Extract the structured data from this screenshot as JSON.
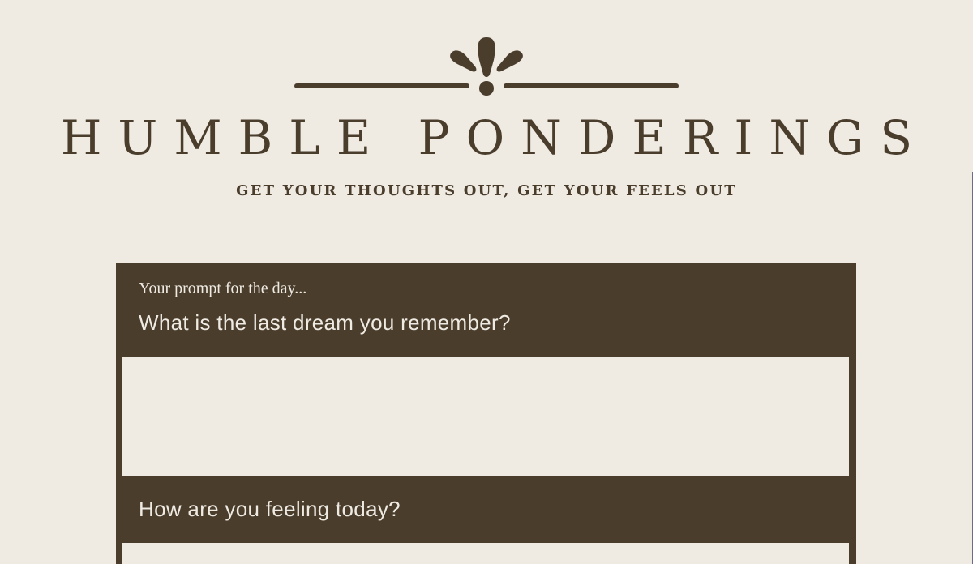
{
  "header": {
    "title": "HUMBLE PONDERINGS",
    "tagline": "GET YOUR THOUGHTS OUT, GET YOUR FEELS OUT",
    "logo_icon": "flower-ornament-icon"
  },
  "journal": {
    "prompt_intro": "Your prompt for the day...",
    "questions": [
      {
        "label": "What is the last dream you remember?",
        "value": ""
      },
      {
        "label": "How are you feeling today?",
        "value": ""
      }
    ]
  },
  "colors": {
    "background": "#efebe3",
    "brown": "#4a3d2c",
    "entry_background": "#efebe3"
  }
}
